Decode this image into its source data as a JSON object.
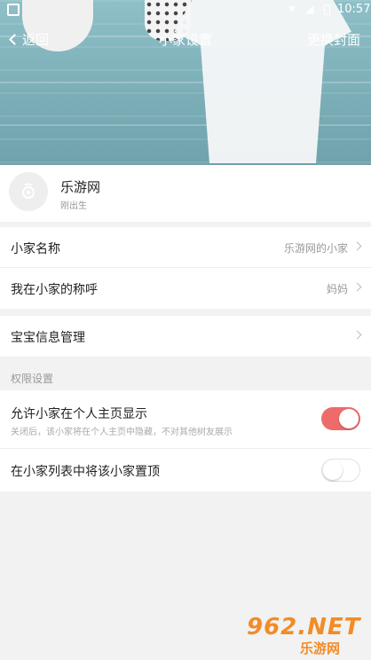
{
  "status_bar": {
    "time": "10:57"
  },
  "nav": {
    "back_label": "返回",
    "title": "小家设置",
    "right_action": "更换封面"
  },
  "profile": {
    "name": "乐游网",
    "subtitle": "刚出生"
  },
  "settings_group_1": [
    {
      "label": "小家名称",
      "value": "乐游网的小家"
    },
    {
      "label": "我在小家的称呼",
      "value": "妈妈"
    }
  ],
  "settings_group_2": [
    {
      "label": "宝宝信息管理",
      "value": ""
    }
  ],
  "permissions": {
    "section_title": "权限设置",
    "items": [
      {
        "label": "允许小家在个人主页显示",
        "description": "关闭后，该小家将在个人主页中隐藏，不对其他树友展示",
        "enabled": true
      },
      {
        "label": "在小家列表中将该小家置顶",
        "description": "",
        "enabled": false
      }
    ]
  },
  "watermark": {
    "main": "962.NET",
    "sub": "乐游网"
  },
  "colors": {
    "toggle_on": "#ee6b6b",
    "background": "#f2f2f2",
    "muted_text": "#999999"
  },
  "icons": [
    "back-chevron-icon",
    "wifi-icon",
    "signal-icon",
    "battery-icon",
    "baby-pacifier-icon",
    "chevron-right-icon"
  ]
}
